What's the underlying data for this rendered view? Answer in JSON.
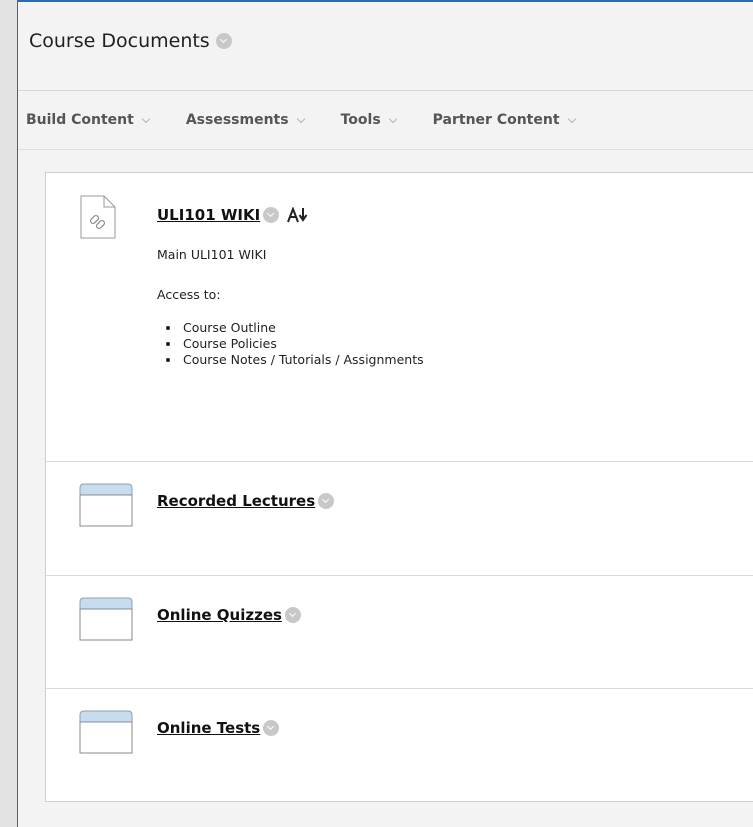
{
  "header": {
    "title": "Course Documents"
  },
  "toolbar": {
    "items": [
      {
        "label": "Build Content"
      },
      {
        "label": "Assessments"
      },
      {
        "label": "Tools"
      },
      {
        "label": "Partner Content"
      }
    ]
  },
  "content": {
    "items": [
      {
        "title": "ULI101 WIKI",
        "description": "Main ULI101 WIKI",
        "access_label": "Access to:",
        "bullets": [
          "Course Outline",
          "Course Policies",
          "Course Notes / Tutorials / Assignments"
        ],
        "alt_formats_icon": "A↓"
      },
      {
        "title": "Recorded Lectures"
      },
      {
        "title": "Online Quizzes"
      },
      {
        "title": "Online Tests"
      }
    ]
  },
  "colors": {
    "accent_border": "#2b6cb0",
    "folder_tab": "#c7dcef"
  }
}
